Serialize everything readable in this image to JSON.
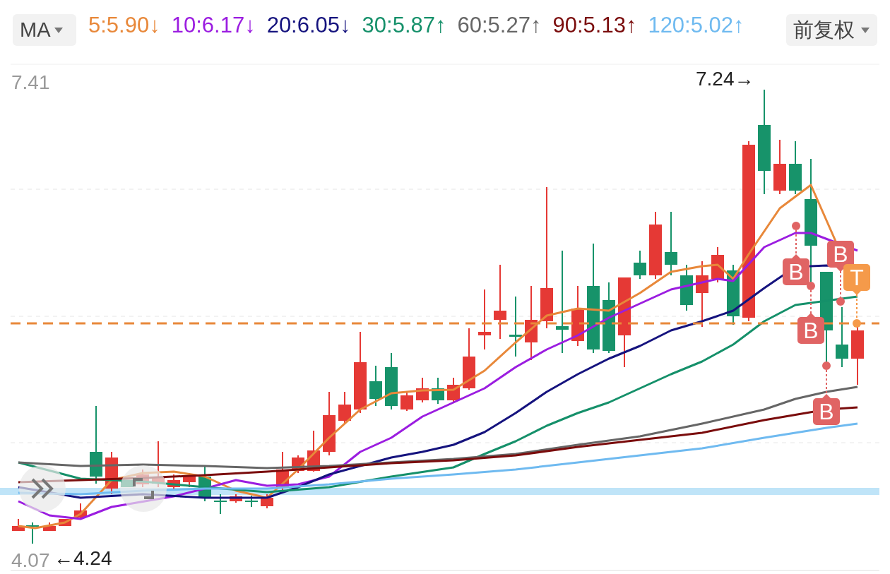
{
  "indicator_dropdown": {
    "label": "MA"
  },
  "ma_legend": [
    {
      "text": "5:5.90↓",
      "color": "#e8883a"
    },
    {
      "text": "10:6.17↓",
      "color": "#9b1de0"
    },
    {
      "text": "20:6.05↓",
      "color": "#15137e"
    },
    {
      "text": "30:5.87↑",
      "color": "#15906a"
    },
    {
      "text": "60:5.27↑",
      "color": "#666666"
    },
    {
      "text": "90:5.13↑",
      "color": "#7a0c0c"
    },
    {
      "text": "120:5.02↑",
      "color": "#6fbaf0"
    }
  ],
  "adjust_dropdown": {
    "label": "前复权"
  },
  "chart": {
    "y_max_label": "7.41",
    "y_min_label": "4.07",
    "high_marker": "7.24→",
    "low_marker": "←4.24",
    "signals": [
      {
        "label": "B",
        "color": "#e06464"
      },
      {
        "label": "B",
        "color": "#e06464"
      },
      {
        "label": "B",
        "color": "#e06464"
      },
      {
        "label": "B",
        "color": "#e06464"
      },
      {
        "label": "T",
        "color": "#f59a4a"
      }
    ]
  }
}
